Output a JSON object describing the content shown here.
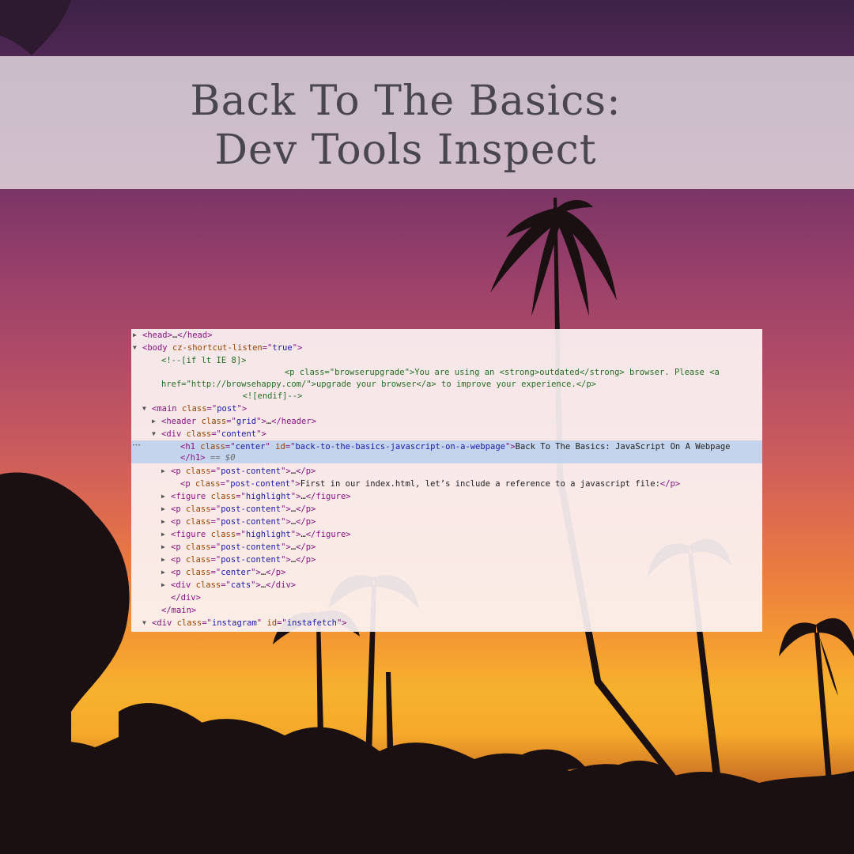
{
  "title": {
    "line1": "Back To The Basics:",
    "line2": "Dev Tools Inspect"
  },
  "colors": {
    "tag": "#881280",
    "attr_name": "#994500",
    "attr_value": "#1a1aa6",
    "comment": "#236e25",
    "selection": "#bed2ec"
  },
  "devtools": {
    "more_icon": "ellipsis-icon",
    "selected_marker": "== $0",
    "nodes": [
      {
        "toggle": "collapsed",
        "segs": [
          [
            "t",
            "<head>"
          ],
          [
            "x",
            "…"
          ],
          [
            "t",
            "</head>"
          ]
        ]
      },
      {
        "toggle": "expanded",
        "segs": [
          [
            "t",
            "<body "
          ],
          [
            "a",
            "cz-shortcut-listen"
          ],
          [
            "t",
            "=\""
          ],
          [
            "v",
            "true"
          ],
          [
            "t",
            "\">"
          ]
        ]
      },
      {
        "toggle": "none",
        "segs": [
          [
            "c",
            "<!--[if lt IE 8]>"
          ]
        ]
      },
      {
        "toggle": "none",
        "segs": [
          [
            "c",
            "            <p class=\"browserupgrade\">You are using an <strong>outdated</strong> browser. Please <a"
          ]
        ]
      },
      {
        "toggle": "none",
        "segs": [
          [
            "c",
            "href=\"http://browsehappy.com/\">upgrade your browser</a> to improve your experience.</p>"
          ]
        ]
      },
      {
        "toggle": "none",
        "segs": [
          [
            "c",
            "        <![endif]-->"
          ]
        ]
      },
      {
        "toggle": "expanded",
        "segs": [
          [
            "t",
            "<main "
          ],
          [
            "a",
            "class"
          ],
          [
            "t",
            "=\""
          ],
          [
            "v",
            "post"
          ],
          [
            "t",
            "\">"
          ]
        ]
      },
      {
        "toggle": "collapsed",
        "segs": [
          [
            "t",
            "<header "
          ],
          [
            "a",
            "class"
          ],
          [
            "t",
            "=\""
          ],
          [
            "v",
            "grid"
          ],
          [
            "t",
            "\">"
          ],
          [
            "x",
            "…"
          ],
          [
            "t",
            "</header>"
          ]
        ]
      },
      {
        "toggle": "expanded",
        "segs": [
          [
            "t",
            "<div "
          ],
          [
            "a",
            "class"
          ],
          [
            "t",
            "=\""
          ],
          [
            "v",
            "content"
          ],
          [
            "t",
            "\">"
          ]
        ]
      },
      {
        "toggle": "none",
        "segs": [
          [
            "t",
            "<h1 "
          ],
          [
            "a",
            "class"
          ],
          [
            "t",
            "=\""
          ],
          [
            "v",
            "center"
          ],
          [
            "t",
            "\" "
          ],
          [
            "a",
            "id"
          ],
          [
            "t",
            "=\""
          ],
          [
            "v",
            "back-to-the-basics-javascript-on-a-webpage"
          ],
          [
            "t",
            "\">"
          ],
          [
            "x",
            "Back To The Basics: JavaScript On A Webpage"
          ]
        ]
      },
      {
        "toggle": "none",
        "segs": [
          [
            "t",
            "</h1>"
          ],
          [
            "eq",
            " == $0"
          ]
        ]
      },
      {
        "toggle": "collapsed",
        "segs": [
          [
            "t",
            "<p "
          ],
          [
            "a",
            "class"
          ],
          [
            "t",
            "=\""
          ],
          [
            "v",
            "post-content"
          ],
          [
            "t",
            "\">"
          ],
          [
            "x",
            "…"
          ],
          [
            "t",
            "</p>"
          ]
        ]
      },
      {
        "toggle": "none",
        "segs": [
          [
            "t",
            "<p "
          ],
          [
            "a",
            "class"
          ],
          [
            "t",
            "=\""
          ],
          [
            "v",
            "post-content"
          ],
          [
            "t",
            "\">"
          ],
          [
            "x",
            "First in our index.html, let’s include a reference to a javascript file:"
          ],
          [
            "t",
            "</p>"
          ]
        ]
      },
      {
        "toggle": "collapsed",
        "segs": [
          [
            "t",
            "<figure "
          ],
          [
            "a",
            "class"
          ],
          [
            "t",
            "=\""
          ],
          [
            "v",
            "highlight"
          ],
          [
            "t",
            "\">"
          ],
          [
            "x",
            "…"
          ],
          [
            "t",
            "</figure>"
          ]
        ]
      },
      {
        "toggle": "collapsed",
        "segs": [
          [
            "t",
            "<p "
          ],
          [
            "a",
            "class"
          ],
          [
            "t",
            "=\""
          ],
          [
            "v",
            "post-content"
          ],
          [
            "t",
            "\">"
          ],
          [
            "x",
            "…"
          ],
          [
            "t",
            "</p>"
          ]
        ]
      },
      {
        "toggle": "collapsed",
        "segs": [
          [
            "t",
            "<p "
          ],
          [
            "a",
            "class"
          ],
          [
            "t",
            "=\""
          ],
          [
            "v",
            "post-content"
          ],
          [
            "t",
            "\">"
          ],
          [
            "x",
            "…"
          ],
          [
            "t",
            "</p>"
          ]
        ]
      },
      {
        "toggle": "collapsed",
        "segs": [
          [
            "t",
            "<figure "
          ],
          [
            "a",
            "class"
          ],
          [
            "t",
            "=\""
          ],
          [
            "v",
            "highlight"
          ],
          [
            "t",
            "\">"
          ],
          [
            "x",
            "…"
          ],
          [
            "t",
            "</figure>"
          ]
        ]
      },
      {
        "toggle": "collapsed",
        "segs": [
          [
            "t",
            "<p "
          ],
          [
            "a",
            "class"
          ],
          [
            "t",
            "=\""
          ],
          [
            "v",
            "post-content"
          ],
          [
            "t",
            "\">"
          ],
          [
            "x",
            "…"
          ],
          [
            "t",
            "</p>"
          ]
        ]
      },
      {
        "toggle": "collapsed",
        "segs": [
          [
            "t",
            "<p "
          ],
          [
            "a",
            "class"
          ],
          [
            "t",
            "=\""
          ],
          [
            "v",
            "post-content"
          ],
          [
            "t",
            "\">"
          ],
          [
            "x",
            "…"
          ],
          [
            "t",
            "</p>"
          ]
        ]
      },
      {
        "toggle": "collapsed",
        "segs": [
          [
            "t",
            "<p "
          ],
          [
            "a",
            "class"
          ],
          [
            "t",
            "=\""
          ],
          [
            "v",
            "center"
          ],
          [
            "t",
            "\">"
          ],
          [
            "x",
            "…"
          ],
          [
            "t",
            "</p>"
          ]
        ]
      },
      {
        "toggle": "collapsed",
        "segs": [
          [
            "t",
            "<div "
          ],
          [
            "a",
            "class"
          ],
          [
            "t",
            "=\""
          ],
          [
            "v",
            "cats"
          ],
          [
            "t",
            "\">"
          ],
          [
            "x",
            "…"
          ],
          [
            "t",
            "</div>"
          ]
        ]
      },
      {
        "toggle": "none",
        "segs": [
          [
            "t",
            "</div>"
          ]
        ]
      },
      {
        "toggle": "none",
        "segs": [
          [
            "t",
            "</main>"
          ]
        ]
      },
      {
        "toggle": "expanded",
        "segs": [
          [
            "t",
            "<div "
          ],
          [
            "a",
            "class"
          ],
          [
            "t",
            "=\""
          ],
          [
            "v",
            "instagram"
          ],
          [
            "t",
            "\" "
          ],
          [
            "a",
            "id"
          ],
          [
            "t",
            "=\""
          ],
          [
            "v",
            "instafetch"
          ],
          [
            "t",
            "\">"
          ]
        ]
      }
    ]
  }
}
